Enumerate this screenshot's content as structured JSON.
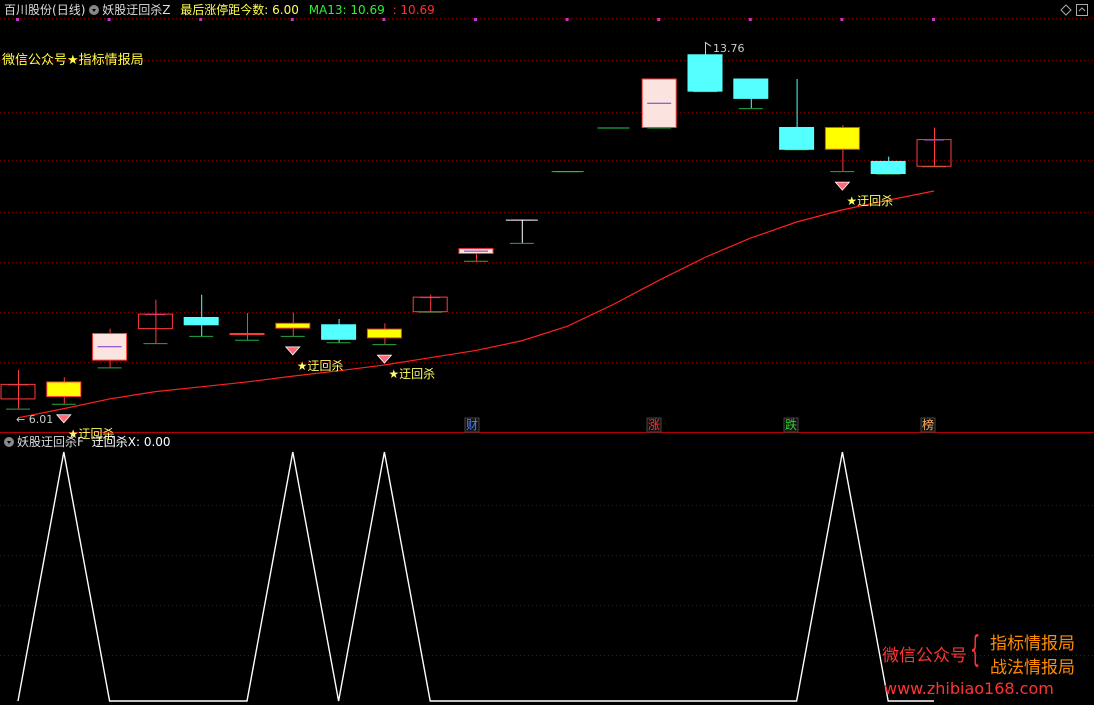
{
  "header": {
    "stock_name": "百川股份",
    "period": "(日线)",
    "indicator_main": "妖股迂回杀Z",
    "limit_label": "最后涨停距今数: 6.00",
    "ma_label": "MA13: 10.69",
    "price_label": ": 10.69"
  },
  "watermark_top": "微信公众号★指标情报局",
  "annotations": {
    "high_price": "13.76",
    "low_price": "6.01",
    "signal_label": "★迂回杀"
  },
  "markers": [
    {
      "label": "财",
      "color": "#4f7fff"
    },
    {
      "label": "涨",
      "color": "#ff3030"
    },
    {
      "label": "跌",
      "color": "#30d030"
    },
    {
      "label": "榜",
      "color": "#ffb060"
    }
  ],
  "sub_panel": {
    "indicator": "妖股迂回杀F",
    "series_label": "迂回杀X: 0.00"
  },
  "watermark_bottom": {
    "left": "微信公众号",
    "brace": "{",
    "line1": "指标情报局",
    "line2": "战法情报局",
    "url": "www.zhibiao168.com"
  },
  "colors": {
    "up": "#ff3c3c",
    "down": "#54ffff",
    "doji_yellow": "#ffff00",
    "ma": "#ff2020",
    "header_yellow": "#ffff55",
    "header_green": "#33ee33",
    "header_red": "#ff3030",
    "grid_red": "#7a0000",
    "purple_dot": "#cc33cc"
  },
  "chart_data": {
    "type": "candlestick",
    "price_axis": [
      5.8,
      14.3
    ],
    "candles": [
      {
        "open": 6.4,
        "close": 6.7,
        "high": 7.0,
        "low": 6.2,
        "style": "hollow_red"
      },
      {
        "open": 6.45,
        "close": 6.75,
        "high": 6.85,
        "low": 6.3,
        "style": "yellow"
      },
      {
        "open": 7.2,
        "close": 7.75,
        "high": 7.85,
        "low": 7.05,
        "style": "pink"
      },
      {
        "open": 7.85,
        "close": 8.15,
        "high": 8.45,
        "low": 7.55,
        "style": "hollow_red"
      },
      {
        "open": 7.93,
        "close": 8.08,
        "high": 8.55,
        "low": 7.7,
        "style": "cyan"
      },
      {
        "open": 7.73,
        "close": 7.75,
        "high": 8.17,
        "low": 7.62,
        "style": "hollow_red"
      },
      {
        "open": 7.86,
        "close": 7.96,
        "high": 8.18,
        "low": 7.7,
        "style": "yellow"
      },
      {
        "open": 7.93,
        "close": 7.63,
        "high": 8.05,
        "low": 7.57,
        "style": "cyan"
      },
      {
        "open": 7.66,
        "close": 7.84,
        "high": 7.96,
        "low": 7.53,
        "style": "yellow"
      },
      {
        "open": 8.2,
        "close": 8.5,
        "high": 8.55,
        "low": 8.2,
        "style": "hollow_red"
      },
      {
        "open": 9.4,
        "close": 9.5,
        "high": 9.5,
        "low": 9.25,
        "style": "pink"
      },
      {
        "open": 10.1,
        "close": 10.1,
        "high": 10.1,
        "low": 9.62,
        "style": "doji_purple"
      },
      {
        "open": 11.1,
        "close": 11.1,
        "high": 11.1,
        "low": 11.1,
        "style": "flat_green"
      },
      {
        "open": 12.0,
        "close": 12.0,
        "high": 12.0,
        "low": 12.0,
        "style": "flat_green"
      },
      {
        "open": 12.0,
        "close": 13.0,
        "high": 13.0,
        "low": 12.0,
        "style": "pink"
      },
      {
        "open": 13.5,
        "close": 12.75,
        "high": 13.76,
        "low": 12.75,
        "style": "cyan"
      },
      {
        "open": 13.0,
        "close": 12.6,
        "high": 13.0,
        "low": 12.4,
        "style": "cyan"
      },
      {
        "open": 12.0,
        "close": 11.55,
        "high": 13.0,
        "low": 11.55,
        "style": "cyan"
      },
      {
        "open": 11.55,
        "close": 12.0,
        "high": 12.05,
        "low": 11.1,
        "style": "yellow"
      },
      {
        "open": 11.3,
        "close": 11.05,
        "high": 11.4,
        "low": 11.05,
        "style": "cyan"
      },
      {
        "open": 11.2,
        "close": 11.75,
        "high": 12.0,
        "low": 11.2,
        "style": "hollow_red"
      }
    ],
    "ma13": [
      6.01,
      6.2,
      6.4,
      6.55,
      6.65,
      6.75,
      6.87,
      6.98,
      7.1,
      7.25,
      7.4,
      7.6,
      7.9,
      8.35,
      8.85,
      9.32,
      9.72,
      10.05,
      10.3,
      10.5,
      10.69
    ],
    "signal_candles": [
      1,
      6,
      8,
      18
    ],
    "sub_values": [
      0,
      1,
      0,
      0,
      0,
      0,
      1,
      0,
      1,
      0,
      0,
      0,
      0,
      0,
      0,
      0,
      0,
      0,
      1,
      0,
      0
    ],
    "sub_ylim": [
      0,
      1
    ]
  }
}
